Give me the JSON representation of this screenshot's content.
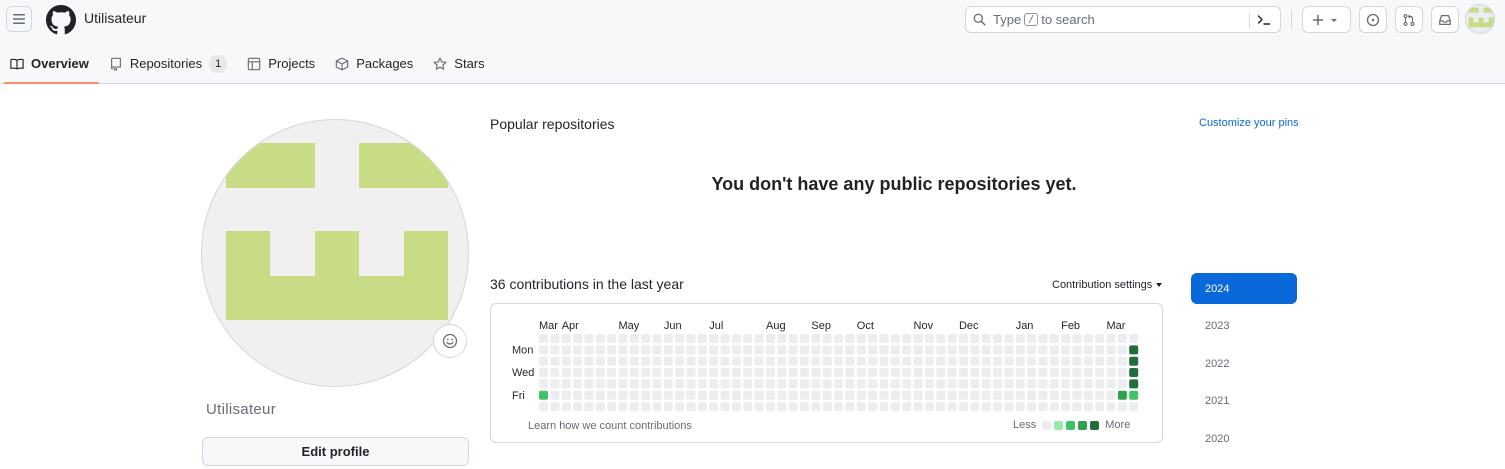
{
  "header": {
    "title": "Utilisateur",
    "search": {
      "prefix": "Type",
      "key": "/",
      "suffix": "to search"
    }
  },
  "tabs": [
    {
      "label": "Overview",
      "icon": "book-icon",
      "selected": true
    },
    {
      "label": "Repositories",
      "icon": "repo-icon",
      "count": "1"
    },
    {
      "label": "Projects",
      "icon": "table-icon"
    },
    {
      "label": "Packages",
      "icon": "package-icon"
    },
    {
      "label": "Stars",
      "icon": "star-icon"
    }
  ],
  "profile": {
    "name": "Utilisateur",
    "edit_label": "Edit profile",
    "avatar_color": "#c8dc86"
  },
  "popular": {
    "title": "Popular repositories",
    "customize": "Customize your pins",
    "empty": "You don't have any public repositories yet."
  },
  "contributions": {
    "title": "36 contributions in the last year",
    "settings": "Contribution settings",
    "months": [
      "Mar",
      "Apr",
      "May",
      "Jun",
      "Jul",
      "Aug",
      "Sep",
      "Oct",
      "Nov",
      "Dec",
      "Jan",
      "Feb",
      "Mar"
    ],
    "month_week_index": [
      0,
      2,
      7,
      11,
      15,
      20,
      24,
      28,
      33,
      37,
      42,
      46,
      50
    ],
    "days": [
      "Mon",
      "Wed",
      "Fri"
    ],
    "weeks": 53,
    "active_cells": [
      {
        "week": 0,
        "day": 5,
        "level": 2
      },
      {
        "week": 51,
        "day": 5,
        "level": 3
      },
      {
        "week": 52,
        "day": 1,
        "level": 4
      },
      {
        "week": 52,
        "day": 2,
        "level": 4
      },
      {
        "week": 52,
        "day": 3,
        "level": 4
      },
      {
        "week": 52,
        "day": 4,
        "level": 4
      },
      {
        "week": 52,
        "day": 5,
        "level": 2
      }
    ],
    "level_colors": [
      "#ebedf0",
      "#9be9a8",
      "#40c463",
      "#30a14e",
      "#216e39"
    ],
    "learn": "Learn how we count contributions",
    "less": "Less",
    "more": "More"
  },
  "years": [
    "2024",
    "2023",
    "2022",
    "2021",
    "2020"
  ],
  "colors": {
    "accent": "#0969da",
    "tab_underline": "#fd8c73"
  }
}
